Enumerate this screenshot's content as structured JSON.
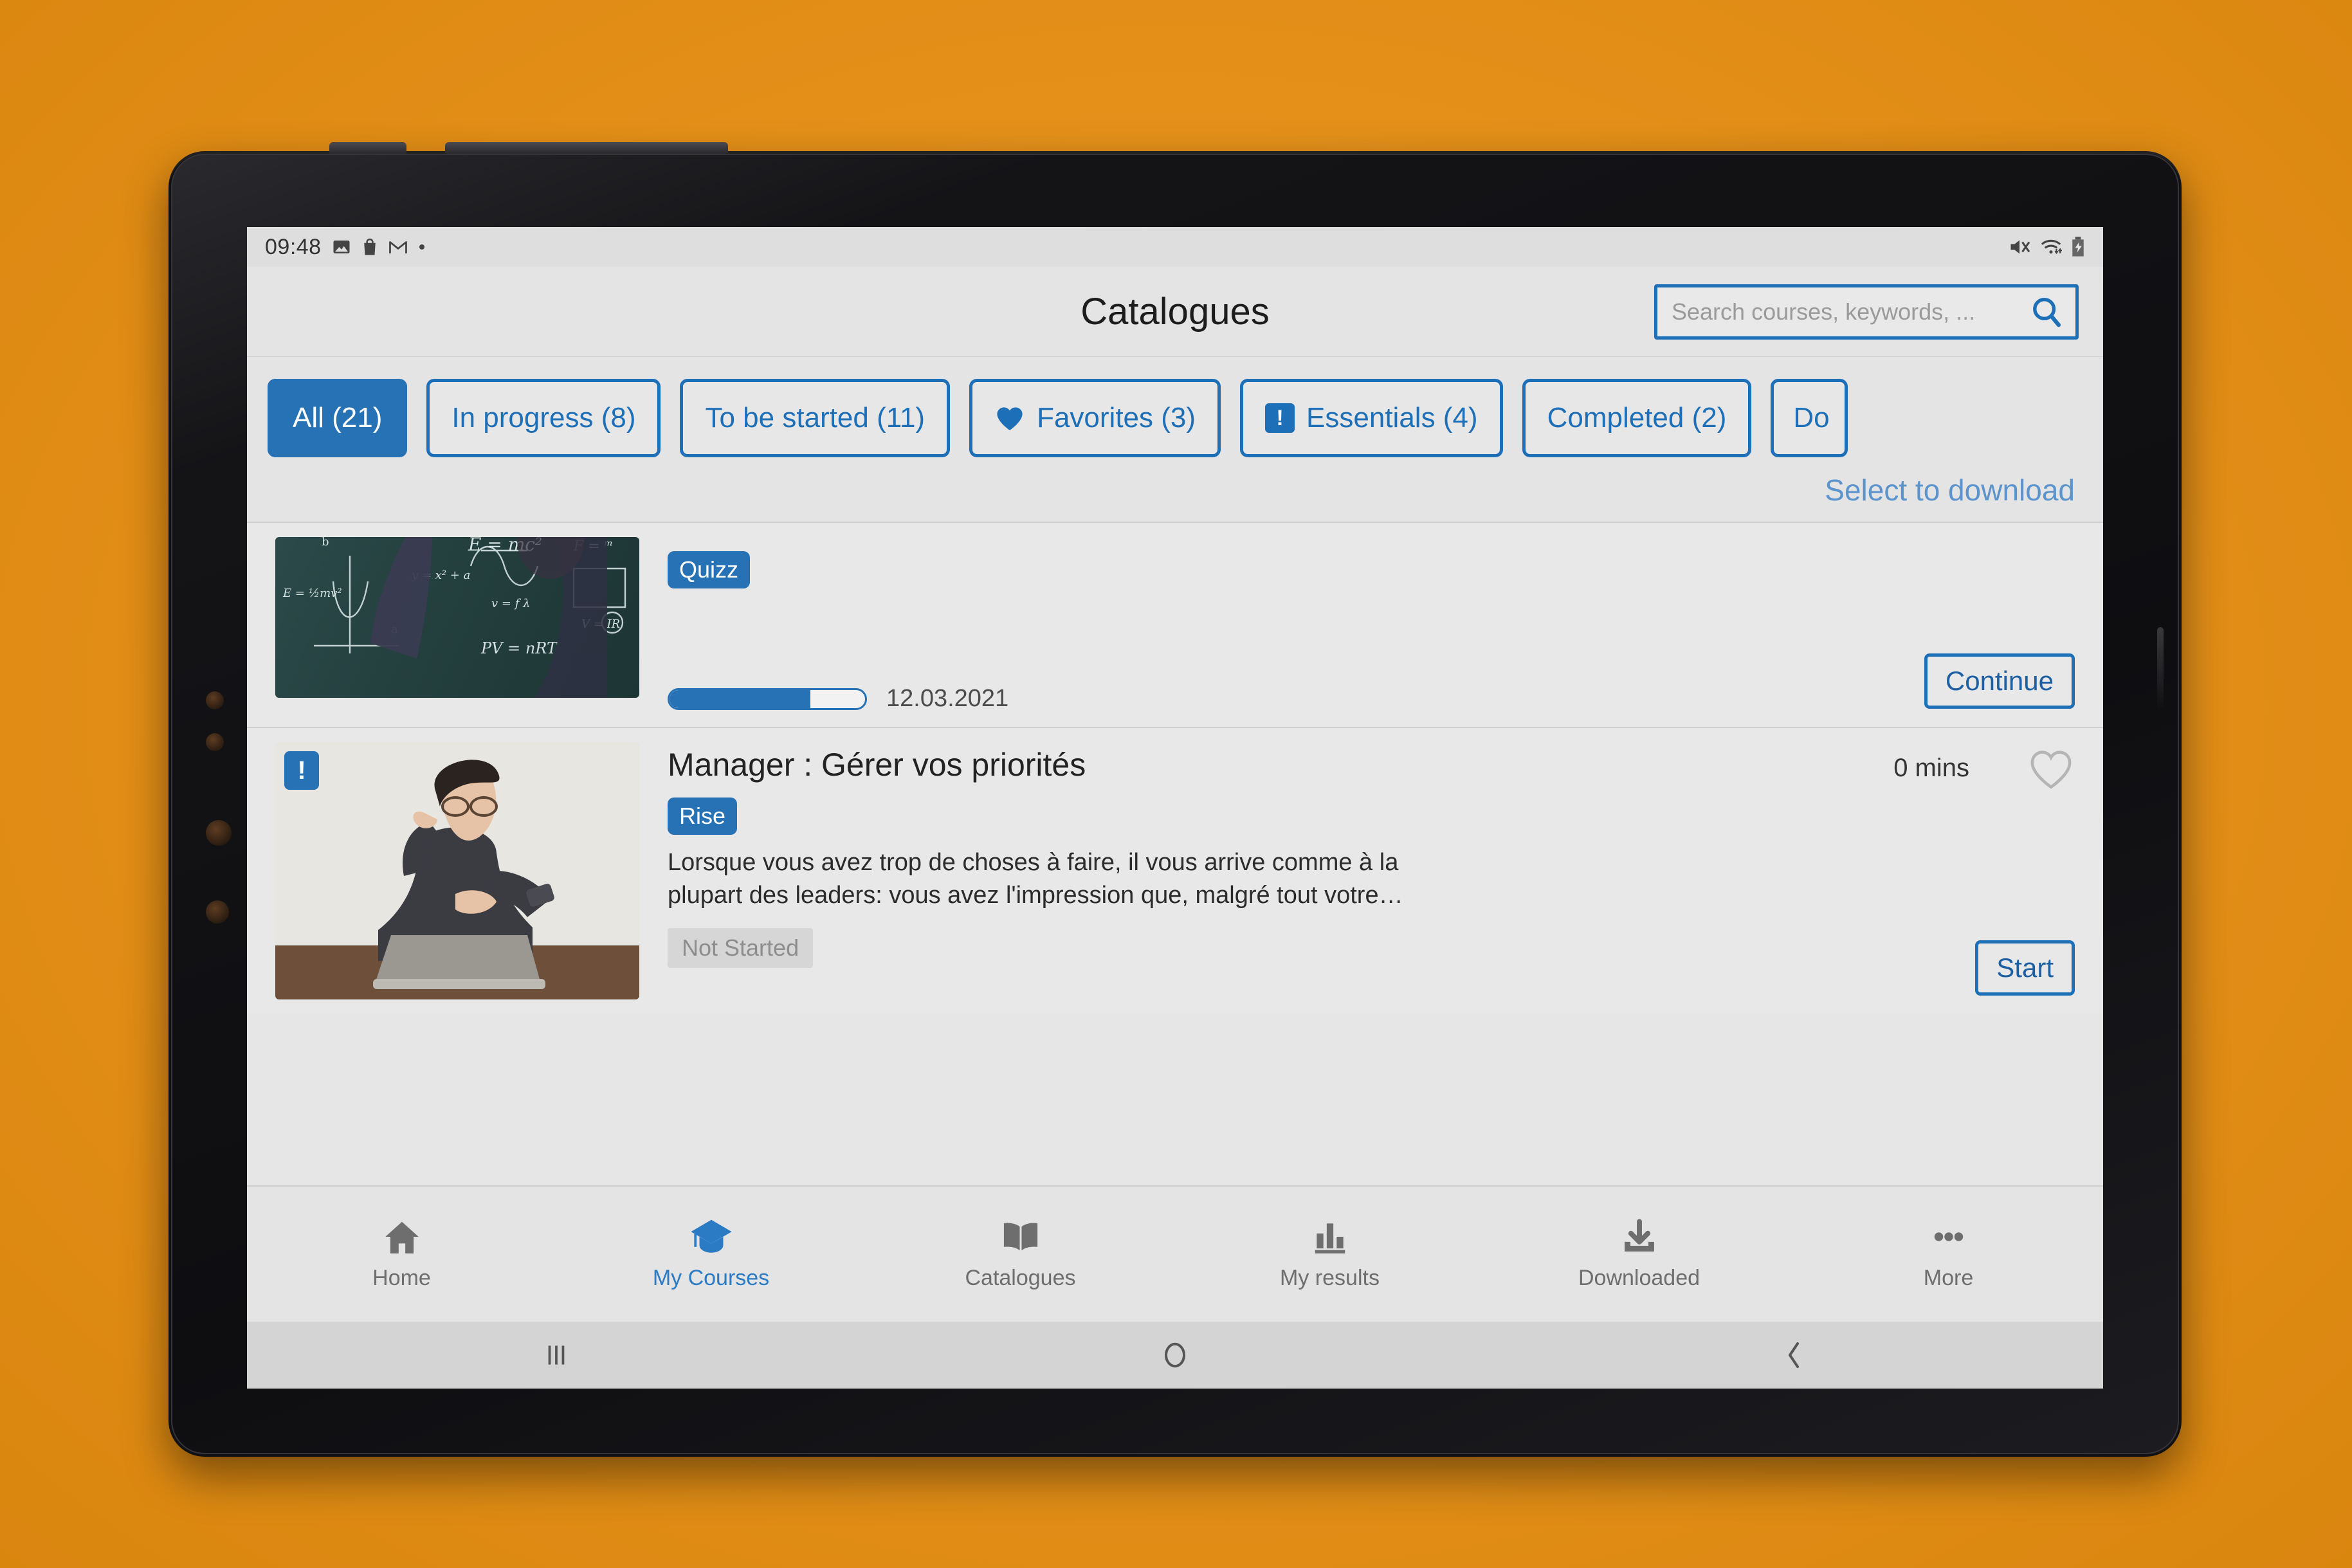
{
  "status_bar": {
    "time": "09:48",
    "left_icons": [
      "image-icon",
      "shopping-bag-icon",
      "gmail-icon",
      "dot-icon"
    ],
    "right_icons": [
      "mute-icon",
      "wifi-icon",
      "battery-charging-icon"
    ]
  },
  "header": {
    "title": "Catalogues",
    "search": {
      "placeholder": "Search courses, keywords, ...",
      "value": "",
      "icon": "search-icon"
    }
  },
  "filters": {
    "chips": [
      {
        "label": "All (21)",
        "active": true,
        "icon": null
      },
      {
        "label": "In progress (8)",
        "active": false,
        "icon": null
      },
      {
        "label": "To be started (11)",
        "active": false,
        "icon": null
      },
      {
        "label": "Favorites (3)",
        "active": false,
        "icon": "heart-filled-icon"
      },
      {
        "label": "Essentials (4)",
        "active": false,
        "icon": "essential-exclamation-icon"
      },
      {
        "label": "Completed (2)",
        "active": false,
        "icon": null
      },
      {
        "label": "Do",
        "active": false,
        "icon": null,
        "clipped": true
      }
    ]
  },
  "toolbar": {
    "select_to_download": "Select to download"
  },
  "courses": [
    {
      "title": "",
      "type_badge": "Quizz",
      "description": "",
      "status": "",
      "duration": "",
      "progress_percent": 72,
      "date": "12.03.2021",
      "action_label": "Continue",
      "essential": false,
      "thumbnail": "chalkboard-formulas-image",
      "clipped": true
    },
    {
      "title": "Manager : Gérer vos priorités",
      "type_badge": "Rise",
      "description": "Lorsque vous avez trop de choses à faire, il vous arrive comme à la plupart des leaders: vous avez l'impression que, malgré tout votre…",
      "status": "Not Started",
      "duration": "0 mins",
      "progress_percent": null,
      "date": "",
      "action_label": "Start",
      "essential": true,
      "essential_icon": "essential-exclamation-icon",
      "favorite_icon": "heart-outline-icon",
      "thumbnail": "person-checking-watch-at-laptop-image",
      "clipped": false
    }
  ],
  "bottom_nav": [
    {
      "label": "Home",
      "icon": "home-icon",
      "active": false
    },
    {
      "label": "My Courses",
      "icon": "graduation-cap-icon",
      "active": true
    },
    {
      "label": "Catalogues",
      "icon": "open-book-icon",
      "active": false
    },
    {
      "label": "My results",
      "icon": "bar-chart-icon",
      "active": false
    },
    {
      "label": "Downloaded",
      "icon": "download-icon",
      "active": false
    },
    {
      "label": "More",
      "icon": "ellipsis-icon",
      "active": false
    }
  ],
  "android_nav": [
    {
      "icon": "recents-icon"
    },
    {
      "icon": "home-circle-icon"
    },
    {
      "icon": "back-chevron-icon"
    }
  ],
  "colors": {
    "background": "#e8941b",
    "accent_blue": "#2672b5",
    "link_blue": "#5b93cd",
    "screen_bg": "#e6e6e6"
  }
}
